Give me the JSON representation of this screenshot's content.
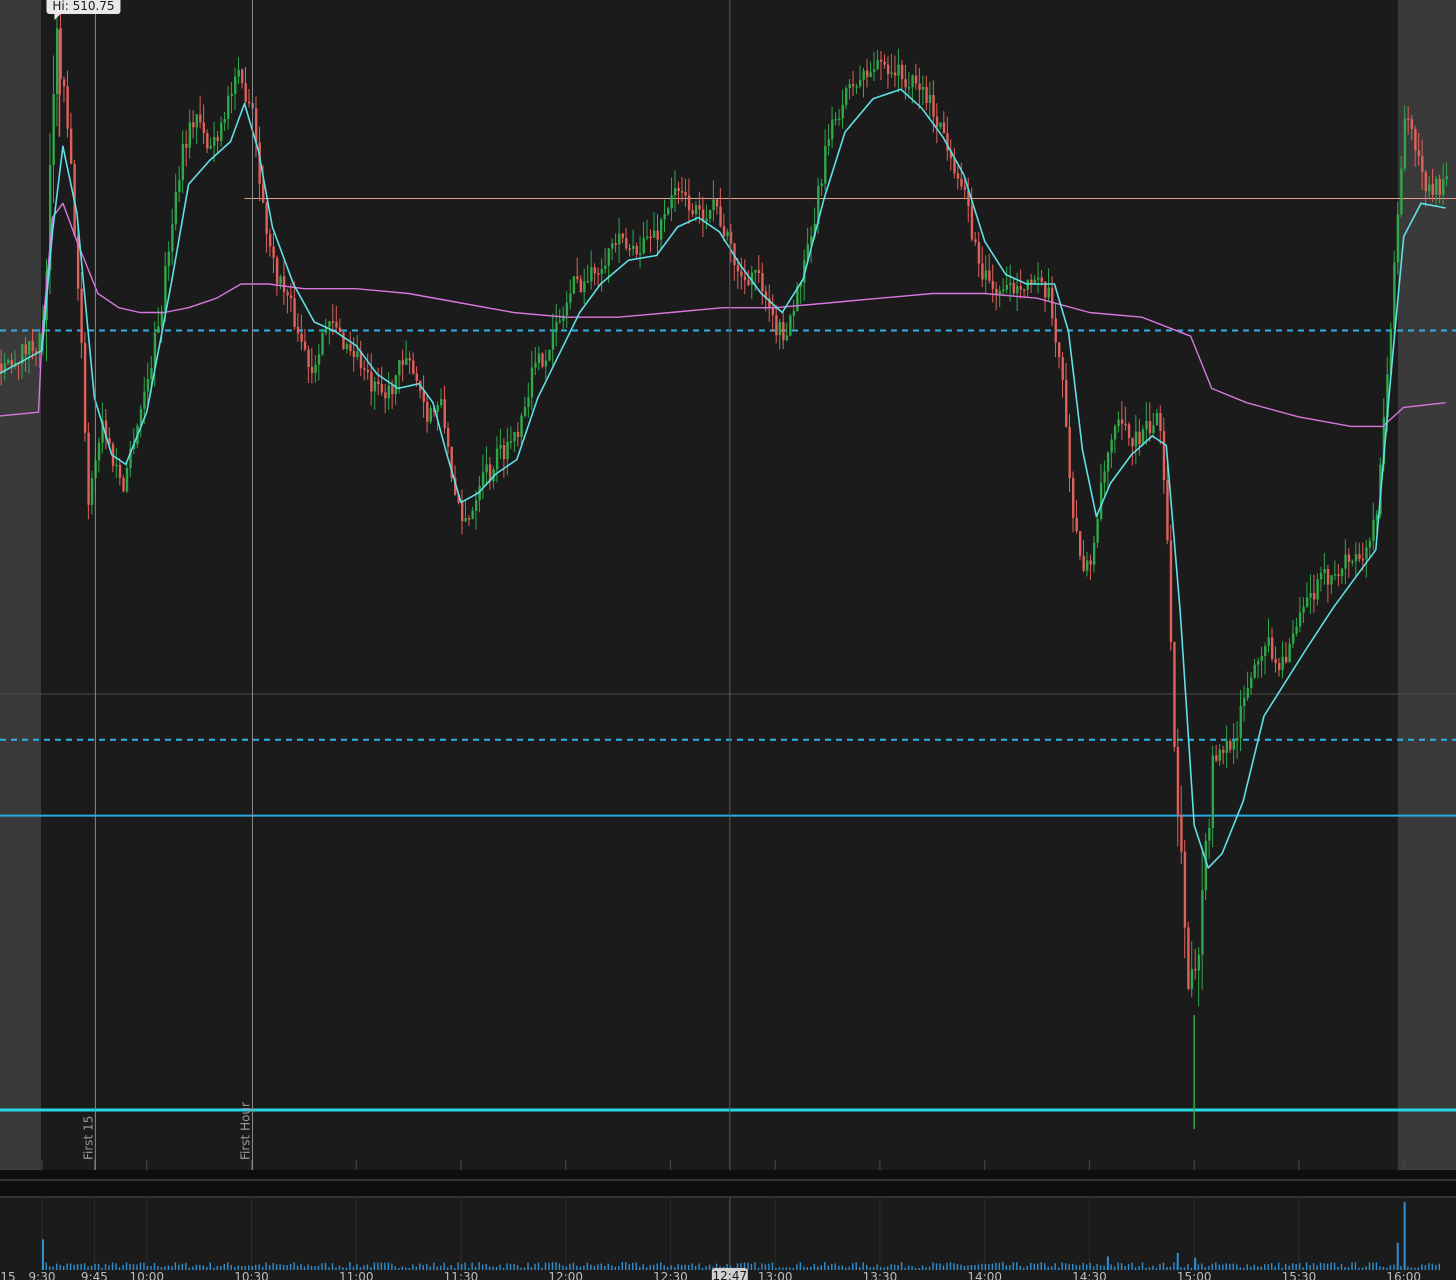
{
  "chart_data": {
    "type": "candlestick",
    "colors": {
      "background": "#1b1b1b",
      "extended_hours": "#3a3a3a",
      "up": "#2fa84a",
      "down": "#e0605a",
      "ema": "#5fe0e6",
      "vwap": "#d877e0",
      "prev_high_level": "#e8a08e",
      "dashed_level": "#2fb2e6",
      "solid_level_1": "#29a9e6",
      "solid_level_2": "#27d9e6",
      "volume": "#2f8fd0",
      "grid": "#3a3a3a"
    },
    "x_ticks": [
      "15",
      "9:30",
      "9:45",
      "10:00",
      "10:30",
      "11:00",
      "11:30",
      "12:00",
      "12:30",
      "13:00",
      "13:30",
      "14:00",
      "14:30",
      "15:00",
      "15:30",
      "16:00"
    ],
    "cursor_time": "12:47",
    "hi_label": "Hi: 510.75",
    "vertical_markers": [
      {
        "time": "9:45",
        "label": "First 15"
      },
      {
        "time": "10:30",
        "label": "First Hour"
      }
    ],
    "price_path": [
      [
        "9:15",
        503.6
      ],
      [
        "9:25",
        504.0
      ],
      [
        "9:30",
        504.3
      ],
      [
        "9:32",
        507.5
      ],
      [
        "9:34",
        510.5
      ],
      [
        "9:36",
        509.4
      ],
      [
        "9:38",
        507.8
      ],
      [
        "9:41",
        504.0
      ],
      [
        "9:43",
        500.8
      ],
      [
        "9:45",
        501.8
      ],
      [
        "9:47",
        502.5
      ],
      [
        "9:50",
        501.7
      ],
      [
        "9:53",
        501.2
      ],
      [
        "9:56",
        502.2
      ],
      [
        "10:00",
        503.4
      ],
      [
        "10:04",
        505.0
      ],
      [
        "10:07",
        506.8
      ],
      [
        "10:10",
        508.3
      ],
      [
        "10:14",
        509.0
      ],
      [
        "10:17",
        508.2
      ],
      [
        "10:20",
        508.6
      ],
      [
        "10:23",
        509.3
      ],
      [
        "10:26",
        509.7
      ],
      [
        "10:30",
        509.2
      ],
      [
        "10:33",
        507.0
      ],
      [
        "10:36",
        505.8
      ],
      [
        "10:40",
        505.1
      ],
      [
        "10:44",
        504.2
      ],
      [
        "10:47",
        503.6
      ],
      [
        "10:50",
        504.4
      ],
      [
        "10:53",
        504.5
      ],
      [
        "10:56",
        504.2
      ],
      [
        "11:00",
        503.9
      ],
      [
        "11:04",
        503.2
      ],
      [
        "11:08",
        503.0
      ],
      [
        "11:12",
        503.6
      ],
      [
        "11:16",
        503.7
      ],
      [
        "11:20",
        502.7
      ],
      [
        "11:24",
        502.8
      ],
      [
        "11:26",
        502.0
      ],
      [
        "11:28",
        500.9
      ],
      [
        "11:30",
        500.3
      ],
      [
        "11:33",
        500.7
      ],
      [
        "11:36",
        501.6
      ],
      [
        "11:38",
        501.4
      ],
      [
        "11:40",
        501.8
      ],
      [
        "11:43",
        502.0
      ],
      [
        "11:46",
        502.4
      ],
      [
        "11:50",
        503.5
      ],
      [
        "11:54",
        504.0
      ],
      [
        "11:58",
        504.6
      ],
      [
        "12:02",
        505.4
      ],
      [
        "12:06",
        505.5
      ],
      [
        "12:10",
        505.9
      ],
      [
        "12:14",
        506.3
      ],
      [
        "12:18",
        506.1
      ],
      [
        "12:22",
        506.3
      ],
      [
        "12:26",
        506.5
      ],
      [
        "12:30",
        507.3
      ],
      [
        "12:34",
        507.2
      ],
      [
        "12:38",
        506.8
      ],
      [
        "12:42",
        507.2
      ],
      [
        "12:46",
        506.3
      ],
      [
        "12:50",
        505.5
      ],
      [
        "12:54",
        505.7
      ],
      [
        "12:58",
        504.7
      ],
      [
        "13:02",
        504.3
      ],
      [
        "13:06",
        505.2
      ],
      [
        "13:10",
        506.3
      ],
      [
        "13:14",
        508.2
      ],
      [
        "13:18",
        509.1
      ],
      [
        "13:22",
        509.6
      ],
      [
        "13:26",
        509.8
      ],
      [
        "13:30",
        510.1
      ],
      [
        "13:34",
        509.9
      ],
      [
        "13:38",
        509.6
      ],
      [
        "13:42",
        509.5
      ],
      [
        "13:46",
        508.9
      ],
      [
        "13:50",
        508.2
      ],
      [
        "13:54",
        507.2
      ],
      [
        "13:58",
        505.8
      ],
      [
        "14:02",
        505.3
      ],
      [
        "14:06",
        505.2
      ],
      [
        "14:10",
        505.5
      ],
      [
        "14:14",
        505.4
      ],
      [
        "14:18",
        505.1
      ],
      [
        "14:22",
        503.5
      ],
      [
        "14:24",
        501.2
      ],
      [
        "14:26",
        500.2
      ],
      [
        "14:28",
        499.3
      ],
      [
        "14:30",
        499.5
      ],
      [
        "14:32",
        500.6
      ],
      [
        "14:35",
        501.8
      ],
      [
        "14:38",
        502.4
      ],
      [
        "14:41",
        502.2
      ],
      [
        "14:44",
        502.1
      ],
      [
        "14:47",
        502.4
      ],
      [
        "14:50",
        502.5
      ],
      [
        "14:52",
        500.2
      ],
      [
        "14:54",
        495.8
      ],
      [
        "14:56",
        493.2
      ],
      [
        "14:58",
        491.0
      ],
      [
        "15:00",
        490.8
      ],
      [
        "15:02",
        492.6
      ],
      [
        "15:05",
        495.1
      ],
      [
        "15:08",
        495.6
      ],
      [
        "15:12",
        496.0
      ],
      [
        "15:16",
        497.2
      ],
      [
        "15:20",
        497.9
      ],
      [
        "15:24",
        497.4
      ],
      [
        "15:28",
        497.9
      ],
      [
        "15:32",
        498.7
      ],
      [
        "15:36",
        499.1
      ],
      [
        "15:40",
        499.4
      ],
      [
        "15:44",
        499.6
      ],
      [
        "15:48",
        499.7
      ],
      [
        "15:52",
        500.4
      ],
      [
        "15:56",
        504.6
      ],
      [
        "16:00",
        509.0
      ],
      [
        "16:03",
        508.3
      ],
      [
        "16:06",
        507.4
      ],
      [
        "16:12",
        507.5
      ]
    ],
    "ema_path": [
      [
        "9:15",
        503.4
      ],
      [
        "9:30",
        504.0
      ],
      [
        "9:33",
        506.5
      ],
      [
        "9:36",
        508.3
      ],
      [
        "9:40",
        506.9
      ],
      [
        "9:45",
        503.0
      ],
      [
        "9:50",
        501.8
      ],
      [
        "9:54",
        501.6
      ],
      [
        "10:00",
        502.7
      ],
      [
        "10:07",
        505.4
      ],
      [
        "10:12",
        507.5
      ],
      [
        "10:18",
        508.0
      ],
      [
        "10:24",
        508.4
      ],
      [
        "10:28",
        509.2
      ],
      [
        "10:32",
        508.2
      ],
      [
        "10:36",
        506.6
      ],
      [
        "10:42",
        505.4
      ],
      [
        "10:48",
        504.6
      ],
      [
        "10:54",
        504.4
      ],
      [
        "11:00",
        504.1
      ],
      [
        "11:06",
        503.5
      ],
      [
        "11:12",
        503.2
      ],
      [
        "11:18",
        503.3
      ],
      [
        "11:22",
        502.9
      ],
      [
        "11:26",
        501.8
      ],
      [
        "11:30",
        500.8
      ],
      [
        "11:35",
        501.0
      ],
      [
        "11:40",
        501.4
      ],
      [
        "11:46",
        501.7
      ],
      [
        "11:52",
        503.0
      ],
      [
        "11:58",
        503.9
      ],
      [
        "12:04",
        504.8
      ],
      [
        "12:10",
        505.4
      ],
      [
        "12:18",
        505.9
      ],
      [
        "12:26",
        506.0
      ],
      [
        "12:32",
        506.6
      ],
      [
        "12:38",
        506.8
      ],
      [
        "12:44",
        506.5
      ],
      [
        "12:50",
        505.8
      ],
      [
        "12:56",
        505.2
      ],
      [
        "13:02",
        504.8
      ],
      [
        "13:08",
        505.5
      ],
      [
        "13:14",
        507.2
      ],
      [
        "13:20",
        508.6
      ],
      [
        "13:28",
        509.3
      ],
      [
        "13:36",
        509.5
      ],
      [
        "13:42",
        509.1
      ],
      [
        "13:48",
        508.5
      ],
      [
        "13:54",
        507.7
      ],
      [
        "14:00",
        506.3
      ],
      [
        "14:06",
        505.6
      ],
      [
        "14:12",
        505.4
      ],
      [
        "14:20",
        505.4
      ],
      [
        "14:24",
        504.4
      ],
      [
        "14:28",
        501.9
      ],
      [
        "14:32",
        500.5
      ],
      [
        "14:36",
        501.2
      ],
      [
        "14:42",
        501.8
      ],
      [
        "14:48",
        502.2
      ],
      [
        "14:52",
        502.0
      ],
      [
        "14:56",
        498.5
      ],
      [
        "15:00",
        494.0
      ],
      [
        "15:04",
        493.1
      ],
      [
        "15:08",
        493.4
      ],
      [
        "15:14",
        494.5
      ],
      [
        "15:20",
        496.3
      ],
      [
        "15:26",
        497.0
      ],
      [
        "15:32",
        497.7
      ],
      [
        "15:40",
        498.6
      ],
      [
        "15:46",
        499.2
      ],
      [
        "15:52",
        499.8
      ],
      [
        "15:56",
        503.2
      ],
      [
        "16:00",
        506.4
      ],
      [
        "16:05",
        507.1
      ],
      [
        "16:12",
        507.0
      ]
    ],
    "vwap_path": [
      [
        "9:15",
        502.6
      ],
      [
        "9:29",
        502.7
      ],
      [
        "9:30",
        504.3
      ],
      [
        "9:33",
        506.8
      ],
      [
        "9:36",
        507.1
      ],
      [
        "9:40",
        506.3
      ],
      [
        "9:46",
        505.2
      ],
      [
        "9:52",
        504.9
      ],
      [
        "9:58",
        504.8
      ],
      [
        "10:05",
        504.8
      ],
      [
        "10:12",
        504.9
      ],
      [
        "10:20",
        505.1
      ],
      [
        "10:27",
        505.4
      ],
      [
        "10:35",
        505.4
      ],
      [
        "10:45",
        505.3
      ],
      [
        "11:00",
        505.3
      ],
      [
        "11:15",
        505.2
      ],
      [
        "11:30",
        505.0
      ],
      [
        "11:45",
        504.8
      ],
      [
        "12:00",
        504.7
      ],
      [
        "12:15",
        504.7
      ],
      [
        "12:30",
        504.8
      ],
      [
        "12:45",
        504.9
      ],
      [
        "13:00",
        504.9
      ],
      [
        "13:15",
        505.0
      ],
      [
        "13:30",
        505.1
      ],
      [
        "13:45",
        505.2
      ],
      [
        "14:00",
        505.2
      ],
      [
        "14:15",
        505.1
      ],
      [
        "14:30",
        504.8
      ],
      [
        "14:45",
        504.7
      ],
      [
        "14:59",
        504.3
      ],
      [
        "15:05",
        503.2
      ],
      [
        "15:15",
        502.9
      ],
      [
        "15:30",
        502.6
      ],
      [
        "15:45",
        502.4
      ],
      [
        "15:54",
        502.4
      ],
      [
        "16:00",
        502.8
      ],
      [
        "16:12",
        502.9
      ]
    ],
    "levels": [
      {
        "price": 507.2,
        "style": "solid-thin",
        "color_key": "prev_high_level",
        "from_time": "10:28"
      },
      {
        "price": 504.42,
        "style": "dashed",
        "color_key": "dashed_level"
      },
      {
        "price": 495.8,
        "style": "dashed",
        "color_key": "dashed_level"
      },
      {
        "price": 494.2,
        "style": "solid",
        "color_key": "solid_level_1"
      },
      {
        "price": 488.0,
        "style": "solid-thick",
        "color_key": "solid_level_2"
      }
    ],
    "volume_spikes": [
      [
        "9:30",
        0.45
      ],
      [
        "14:35",
        0.2
      ],
      [
        "14:55",
        0.25
      ],
      [
        "15:00",
        0.18
      ],
      [
        "15:58",
        0.4
      ],
      [
        "16:00",
        1.0
      ]
    ],
    "y_range": [
      487.5,
      511.0
    ]
  }
}
